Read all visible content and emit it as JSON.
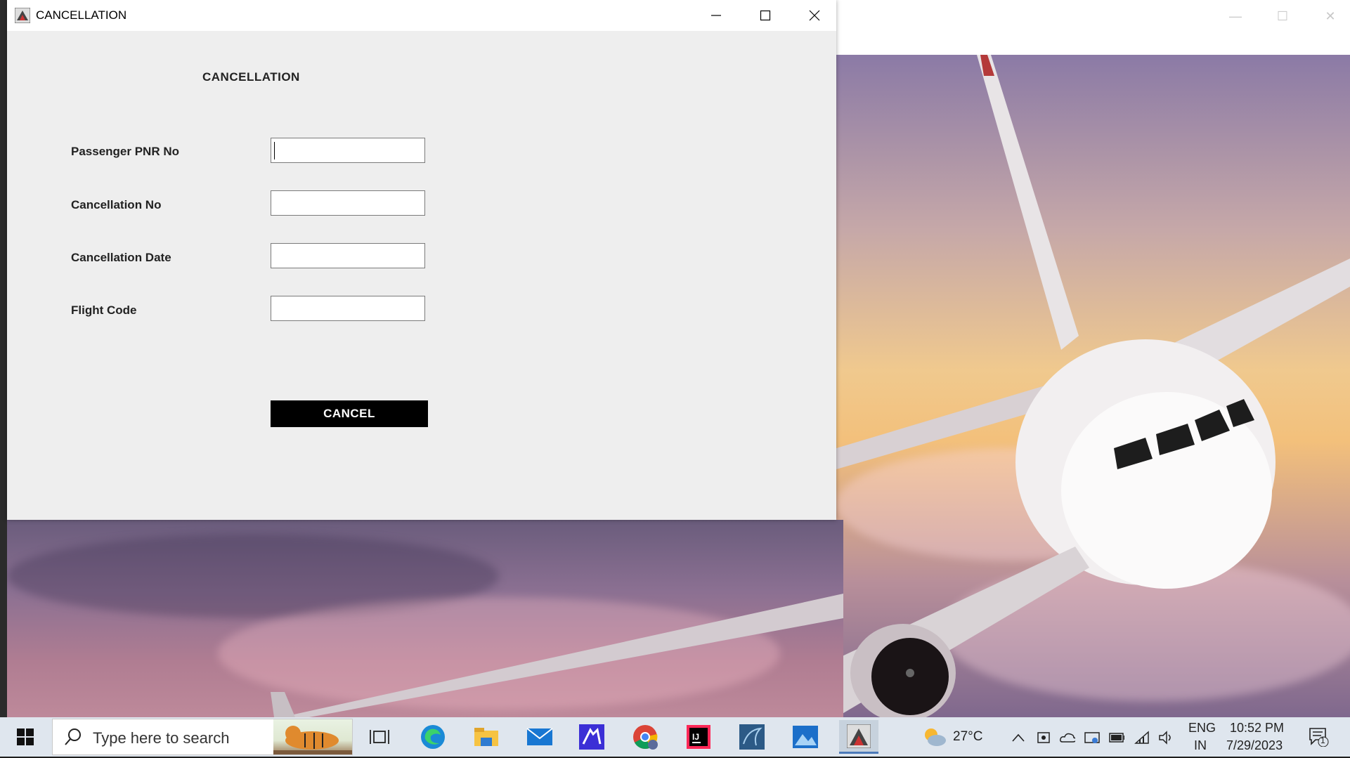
{
  "window": {
    "title": "CANCELLATION",
    "heading": "CANCELLATION",
    "fields": [
      {
        "label": "Passenger PNR No",
        "value": ""
      },
      {
        "label": "Cancellation No",
        "value": ""
      },
      {
        "label": "Cancellation Date",
        "value": ""
      },
      {
        "label": "Flight Code",
        "value": ""
      }
    ],
    "cancel_button": "CANCEL"
  },
  "taskbar": {
    "search_placeholder": "Type here to search",
    "apps": [
      "task-view-icon",
      "edge-icon",
      "file-explorer-icon",
      "mail-icon",
      "vscode-like-icon",
      "chrome-icon",
      "intellij-icon",
      "mysql-workbench-icon",
      "photos-icon",
      "java-app-icon"
    ],
    "weather": "27°C",
    "language_line1": "ENG",
    "language_line2": "IN",
    "time": "10:52 PM",
    "date": "7/29/2023",
    "notification_count": "1"
  }
}
